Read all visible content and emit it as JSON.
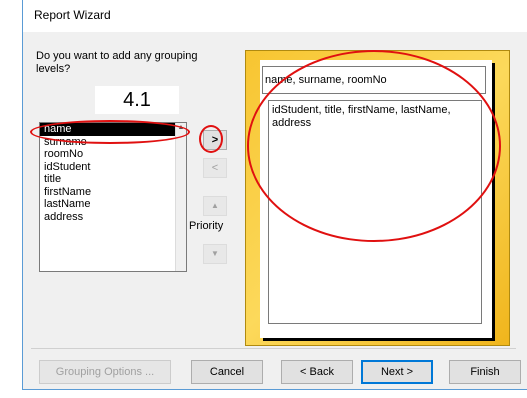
{
  "window": {
    "title": "Report Wizard"
  },
  "wizard": {
    "question": "Do you want to add any grouping levels?",
    "step_label": "4.1",
    "fields": [
      "name",
      "surname",
      "roomNo",
      "idStudent",
      "title",
      "firstName",
      "lastName",
      "address"
    ],
    "selected_field": "name",
    "buttons": {
      "add": ">",
      "remove": "<",
      "priority_up": "▲",
      "priority_down": "▼"
    },
    "priority_label": "Priority"
  },
  "preview": {
    "group_header": "name, surname, roomNo",
    "detail_fields": "idStudent, title, firstName, lastName, address"
  },
  "footer": {
    "grouping_options": "Grouping Options ...",
    "cancel": "Cancel",
    "back": "< Back",
    "next": "Next >",
    "finish": "Finish"
  },
  "colors": {
    "accent": "#0078d7",
    "annotation": "#e01010",
    "preview_frame": "#f7c531"
  }
}
